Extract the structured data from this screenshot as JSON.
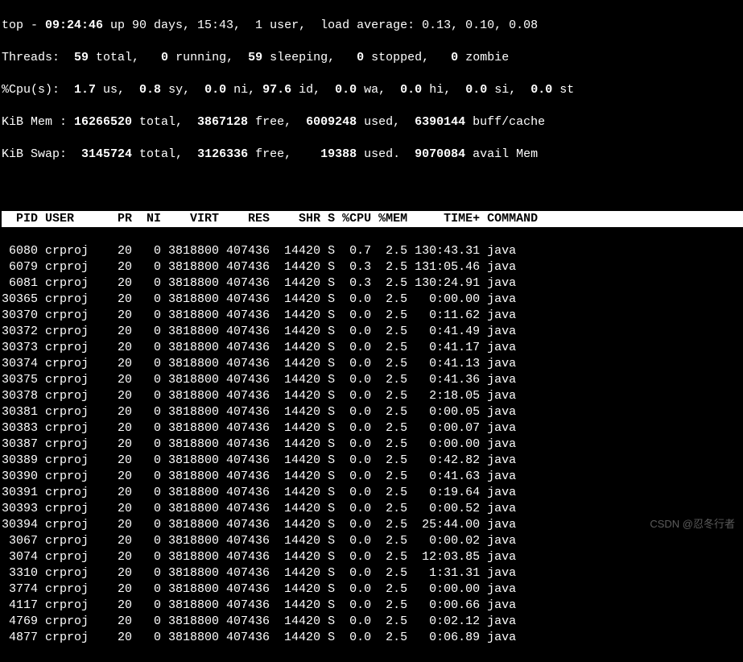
{
  "summary": {
    "line1_a": "top - ",
    "time": "09:24:46",
    "line1_b": " up 90 days, 15:43,  1 user,  load average: 0.13, 0.10, 0.08",
    "line2_a": "Threads: ",
    "threads_total": " 59 ",
    "line2_b": "total,   ",
    "threads_running": "0 ",
    "line2_c": "running,  ",
    "threads_sleeping": "59 ",
    "line2_d": "sleeping,   ",
    "threads_stopped": "0 ",
    "line2_e": "stopped,   ",
    "threads_zombie": "0 ",
    "line2_f": "zombie",
    "line3_a": "%Cpu(s):  ",
    "cpu_us": "1.7 ",
    "line3_b": "us,  ",
    "cpu_sy": "0.8 ",
    "line3_c": "sy,  ",
    "cpu_ni": "0.0 ",
    "line3_d": "ni, ",
    "cpu_id": "97.6 ",
    "line3_e": "id,  ",
    "cpu_wa": "0.0 ",
    "line3_f": "wa,  ",
    "cpu_hi": "0.0 ",
    "line3_g": "hi,  ",
    "cpu_si": "0.0 ",
    "line3_h": "si,  ",
    "cpu_st": "0.0 ",
    "line3_i": "st",
    "line4_a": "KiB Mem : ",
    "mem_total": "16266520 ",
    "line4_b": "total,  ",
    "mem_free": "3867128 ",
    "line4_c": "free,  ",
    "mem_used": "6009248 ",
    "line4_d": "used,  ",
    "mem_cache": "6390144 ",
    "line4_e": "buff/cache",
    "line5_a": "KiB Swap:  ",
    "swap_total": "3145724 ",
    "line5_b": "total,  ",
    "swap_free": "3126336 ",
    "line5_c": "free,    ",
    "swap_used": "19388 ",
    "line5_d": "used.  ",
    "swap_avail": "9070084 ",
    "line5_e": "avail Mem"
  },
  "columns": "  PID USER      PR  NI    VIRT    RES    SHR S %CPU %MEM     TIME+ COMMAND                                ",
  "rows": [
    " 6080 crproj    20   0 3818800 407436  14420 S  0.7  2.5 130:43.31 java",
    " 6079 crproj    20   0 3818800 407436  14420 S  0.3  2.5 131:05.46 java",
    " 6081 crproj    20   0 3818800 407436  14420 S  0.3  2.5 130:24.91 java",
    "30365 crproj    20   0 3818800 407436  14420 S  0.0  2.5   0:00.00 java",
    "30370 crproj    20   0 3818800 407436  14420 S  0.0  2.5   0:11.62 java",
    "30372 crproj    20   0 3818800 407436  14420 S  0.0  2.5   0:41.49 java",
    "30373 crproj    20   0 3818800 407436  14420 S  0.0  2.5   0:41.17 java",
    "30374 crproj    20   0 3818800 407436  14420 S  0.0  2.5   0:41.13 java",
    "30375 crproj    20   0 3818800 407436  14420 S  0.0  2.5   0:41.36 java",
    "30378 crproj    20   0 3818800 407436  14420 S  0.0  2.5   2:18.05 java",
    "30381 crproj    20   0 3818800 407436  14420 S  0.0  2.5   0:00.05 java",
    "30383 crproj    20   0 3818800 407436  14420 S  0.0  2.5   0:00.07 java",
    "30387 crproj    20   0 3818800 407436  14420 S  0.0  2.5   0:00.00 java",
    "30389 crproj    20   0 3818800 407436  14420 S  0.0  2.5   0:42.82 java",
    "30390 crproj    20   0 3818800 407436  14420 S  0.0  2.5   0:41.63 java",
    "30391 crproj    20   0 3818800 407436  14420 S  0.0  2.5   0:19.64 java",
    "30393 crproj    20   0 3818800 407436  14420 S  0.0  2.5   0:00.52 java",
    "30394 crproj    20   0 3818800 407436  14420 S  0.0  2.5  25:44.00 java",
    " 3067 crproj    20   0 3818800 407436  14420 S  0.0  2.5   0:00.02 java",
    " 3074 crproj    20   0 3818800 407436  14420 S  0.0  2.5  12:03.85 java",
    " 3310 crproj    20   0 3818800 407436  14420 S  0.0  2.5   1:31.31 java",
    " 3774 crproj    20   0 3818800 407436  14420 S  0.0  2.5   0:00.00 java",
    " 4117 crproj    20   0 3818800 407436  14420 S  0.0  2.5   0:00.66 java",
    " 4769 crproj    20   0 3818800 407436  14420 S  0.0  2.5   0:02.12 java",
    " 4877 crproj    20   0 3818800 407436  14420 S  0.0  2.5   0:06.89 java"
  ],
  "watermark": "CSDN @忍冬行者"
}
